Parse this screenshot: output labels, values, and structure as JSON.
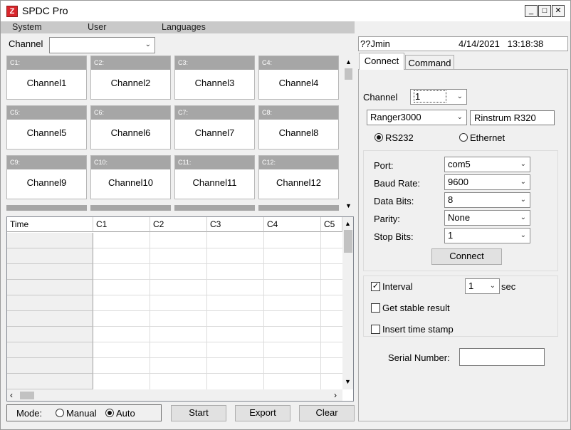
{
  "window": {
    "title": "SPDC Pro",
    "app_icon": "red-z-logo",
    "min_glyph": "_",
    "max_glyph": "□",
    "close_glyph": "✕"
  },
  "menu": [
    "System",
    "User",
    "Languages"
  ],
  "channel_filter": {
    "label": "Channel",
    "value": ""
  },
  "channels": [
    {
      "code": "C1:",
      "name": "Channel1"
    },
    {
      "code": "C2:",
      "name": "Channel2"
    },
    {
      "code": "C3:",
      "name": "Channel3"
    },
    {
      "code": "C4:",
      "name": "Channel4"
    },
    {
      "code": "C5:",
      "name": "Channel5"
    },
    {
      "code": "C6:",
      "name": "Channel6"
    },
    {
      "code": "C7:",
      "name": "Channel7"
    },
    {
      "code": "C8:",
      "name": "Channel8"
    },
    {
      "code": "C9:",
      "name": "Channel9"
    },
    {
      "code": "C10:",
      "name": "Channel10"
    },
    {
      "code": "C11:",
      "name": "Channel11"
    },
    {
      "code": "C12:",
      "name": "Channel12"
    }
  ],
  "table": {
    "columns": [
      "Time",
      "C1",
      "C2",
      "C3",
      "C4",
      "C5"
    ]
  },
  "mode": {
    "label": "Mode:",
    "manual": "Manual",
    "auto": "Auto",
    "selected": "auto"
  },
  "actions": {
    "start": "Start",
    "export": "Export",
    "clear": "Clear"
  },
  "status": {
    "user": "??Jmin",
    "datetime": "4/14/2021   13:18:38"
  },
  "tabs": {
    "connect": "Connect",
    "command": "Command"
  },
  "connect": {
    "channel_label": "Channel",
    "channel_value": "1",
    "model": "Ranger3000",
    "model_name": "Rinstrum R320",
    "rs232": "RS232",
    "ethernet": "Ethernet",
    "conn_selected": "rs232",
    "port_label": "Port:",
    "port": "com5",
    "baud_label": "Baud Rate:",
    "baud": "9600",
    "databits_label": "Data Bits:",
    "databits": "8",
    "parity_label": "Parity:",
    "parity": "None",
    "stopbits_label": "Stop Bits:",
    "stopbits": "1",
    "connect_button": "Connect",
    "interval_label": "Interval",
    "interval_checked": true,
    "interval_value": "1",
    "interval_unit": "sec",
    "stable_label": "Get stable result",
    "stable_checked": false,
    "timestamp_label": "Insert time stamp",
    "timestamp_checked": false,
    "serial_label": "Serial Number:",
    "serial_value": ""
  }
}
